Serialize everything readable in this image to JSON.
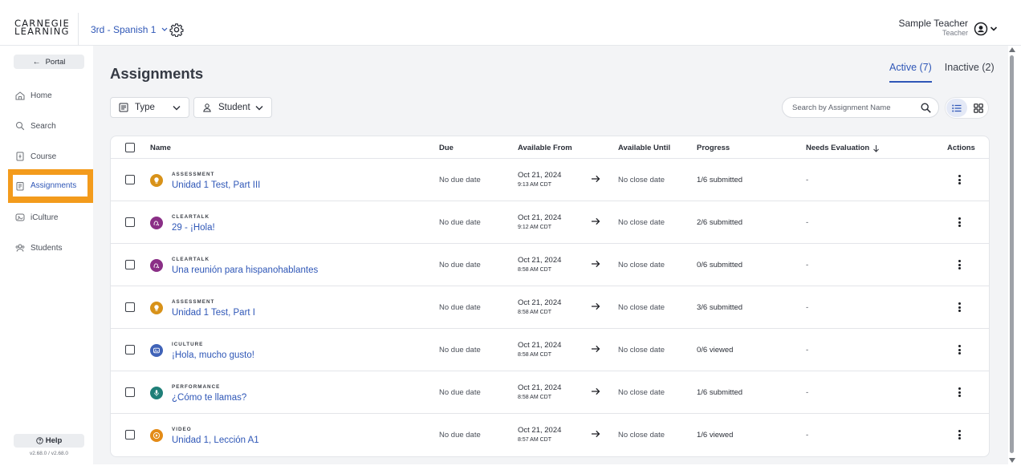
{
  "header": {
    "logo_line1": "CARNEGIE",
    "logo_line2": "LEARNING",
    "class_name": "3rd - Spanish 1",
    "user_name": "Sample Teacher",
    "user_role": "Teacher"
  },
  "sidebar": {
    "portal_label": "Portal",
    "items": [
      {
        "label": "Home",
        "icon": "home-icon"
      },
      {
        "label": "Search",
        "icon": "search-icon"
      },
      {
        "label": "Course",
        "icon": "course-icon"
      },
      {
        "label": "Assignments",
        "icon": "assignments-icon"
      },
      {
        "label": "iCulture",
        "icon": "iculture-icon"
      },
      {
        "label": "Students",
        "icon": "students-icon"
      }
    ],
    "active_item": "Assignments",
    "help_label": "Help",
    "version": "v2.68.0 / v2.68.0"
  },
  "main": {
    "title": "Assignments",
    "tabs": [
      {
        "label": "Active (7)",
        "active": true
      },
      {
        "label": "Inactive (2)",
        "active": false
      }
    ],
    "filters": {
      "type_label": "Type",
      "student_label": "Student"
    },
    "search": {
      "placeholder": "Search by Assignment Name"
    }
  },
  "table": {
    "columns": [
      "Name",
      "Due",
      "Available From",
      "Available Until",
      "Progress",
      "Needs Evaluation",
      "Actions"
    ],
    "rows": [
      {
        "type": "ASSESSMENT",
        "icon": "lightbulb-icon",
        "color": "#d89219",
        "name": "Unidad 1 Test, Part III",
        "due": "No due date",
        "from_date": "Oct 21, 2024",
        "from_time": "9:13 AM CDT",
        "until": "No close date",
        "progress": "1/6 submitted",
        "needs": "-"
      },
      {
        "type": "CLEARTALK",
        "icon": "cleartalk-icon",
        "color": "#8a2f86",
        "name": "29 - ¡Hola!",
        "due": "No due date",
        "from_date": "Oct 21, 2024",
        "from_time": "9:12 AM CDT",
        "until": "No close date",
        "progress": "2/6 submitted",
        "needs": "-"
      },
      {
        "type": "CLEARTALK",
        "icon": "cleartalk-icon",
        "color": "#8a2f86",
        "name": "Una reunión para hispanohablantes",
        "due": "No due date",
        "from_date": "Oct 21, 2024",
        "from_time": "8:58 AM CDT",
        "until": "No close date",
        "progress": "0/6 submitted",
        "needs": "-"
      },
      {
        "type": "ASSESSMENT",
        "icon": "lightbulb-icon",
        "color": "#d89219",
        "name": "Unidad 1 Test, Part I",
        "due": "No due date",
        "from_date": "Oct 21, 2024",
        "from_time": "8:58 AM CDT",
        "until": "No close date",
        "progress": "3/6 submitted",
        "needs": "-"
      },
      {
        "type": "ICULTURE",
        "icon": "iculture-icon",
        "color": "#4063b8",
        "name": "¡Hola, mucho gusto!",
        "due": "No due date",
        "from_date": "Oct 21, 2024",
        "from_time": "8:58 AM CDT",
        "until": "No close date",
        "progress": "0/6 viewed",
        "needs": "-"
      },
      {
        "type": "PERFORMANCE",
        "icon": "microphone-icon",
        "color": "#1f7f78",
        "name": "¿Cómo te llamas?",
        "due": "No due date",
        "from_date": "Oct 21, 2024",
        "from_time": "8:58 AM CDT",
        "until": "No close date",
        "progress": "1/6 submitted",
        "needs": "-"
      },
      {
        "type": "VIDEO",
        "icon": "play-icon",
        "color": "#e38b17",
        "name": "Unidad 1, Lección A1",
        "due": "No due date",
        "from_date": "Oct 21, 2024",
        "from_time": "8:57 AM CDT",
        "until": "No close date",
        "progress": "1/6 viewed",
        "needs": "-"
      }
    ]
  }
}
